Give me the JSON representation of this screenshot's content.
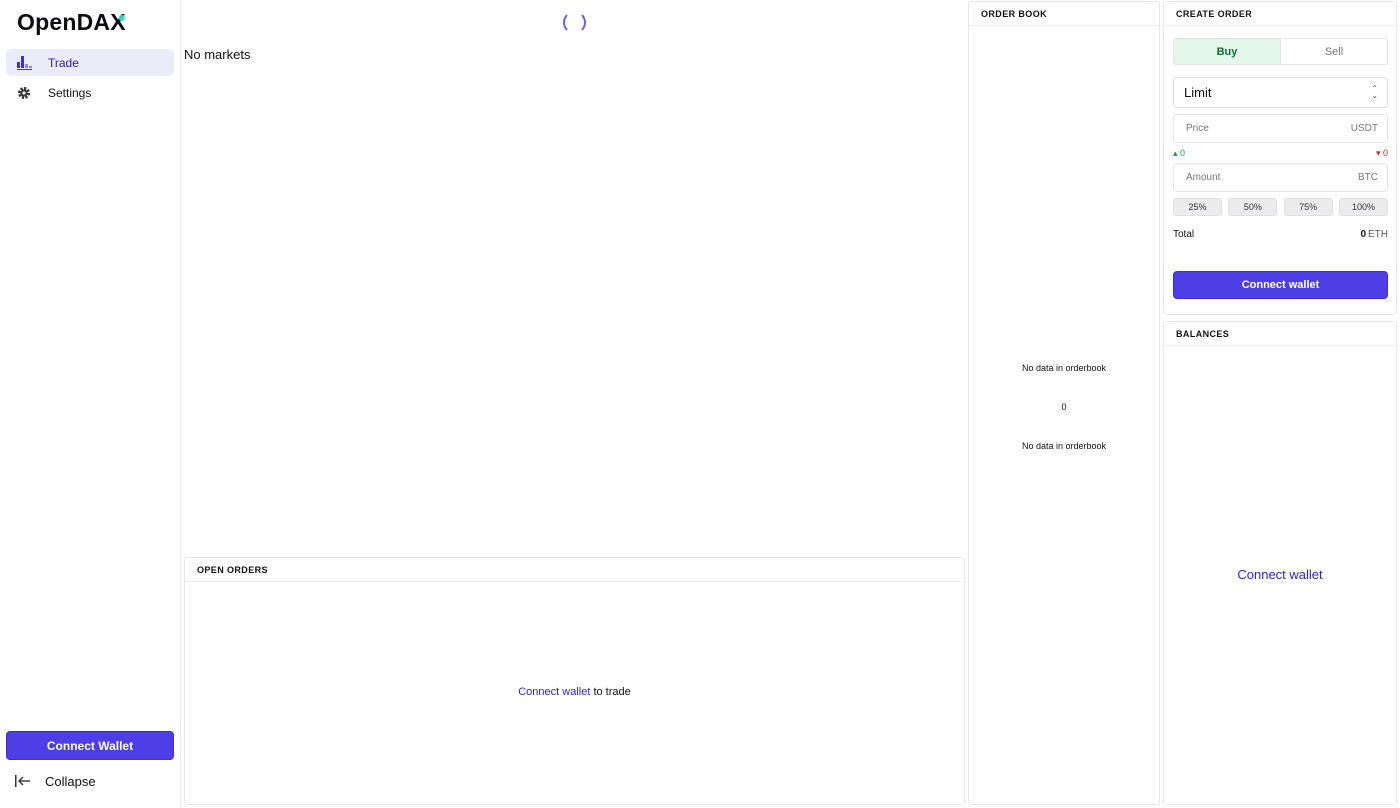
{
  "app": {
    "logo_text": "OpenDA",
    "logo_x": "X"
  },
  "sidebar": {
    "items": [
      {
        "label": "Trade",
        "icon": "chart-bars-icon",
        "active": true
      },
      {
        "label": "Settings",
        "icon": "gear-icon",
        "active": false
      }
    ],
    "connect_label": "Connect Wallet",
    "collapse_label": "Collapse"
  },
  "chart": {
    "status_text": "No markets"
  },
  "open_orders": {
    "title": "OPEN ORDERS",
    "link_text": "Connect wallet",
    "suffix_text": " to trade"
  },
  "order_book": {
    "title": "ORDER BOOK",
    "empty_top": "No data in orderbook",
    "mid_value": "0",
    "empty_bottom": "No data in orderbook"
  },
  "create_order": {
    "title": "CREATE ORDER",
    "tabs": {
      "buy": "Buy",
      "sell": "Sell"
    },
    "order_type": "Limit",
    "price": {
      "placeholder": "Price",
      "unit": "USDT"
    },
    "up_value": "0",
    "down_value": "0",
    "amount": {
      "placeholder": "Amount",
      "unit": "BTC"
    },
    "percents": [
      "25%",
      "50%",
      "75%",
      "100%"
    ],
    "total_label": "Total",
    "total_value": "0",
    "total_currency": "ETH",
    "connect_label": "Connect wallet"
  },
  "balances": {
    "title": "BALANCES",
    "connect_label": "Connect wallet"
  },
  "colors": {
    "accent": "#4e3ee6",
    "link": "#2b1fc9",
    "buy_bg": "#e3f7ea",
    "up": "#169653",
    "down": "#d3262d"
  }
}
